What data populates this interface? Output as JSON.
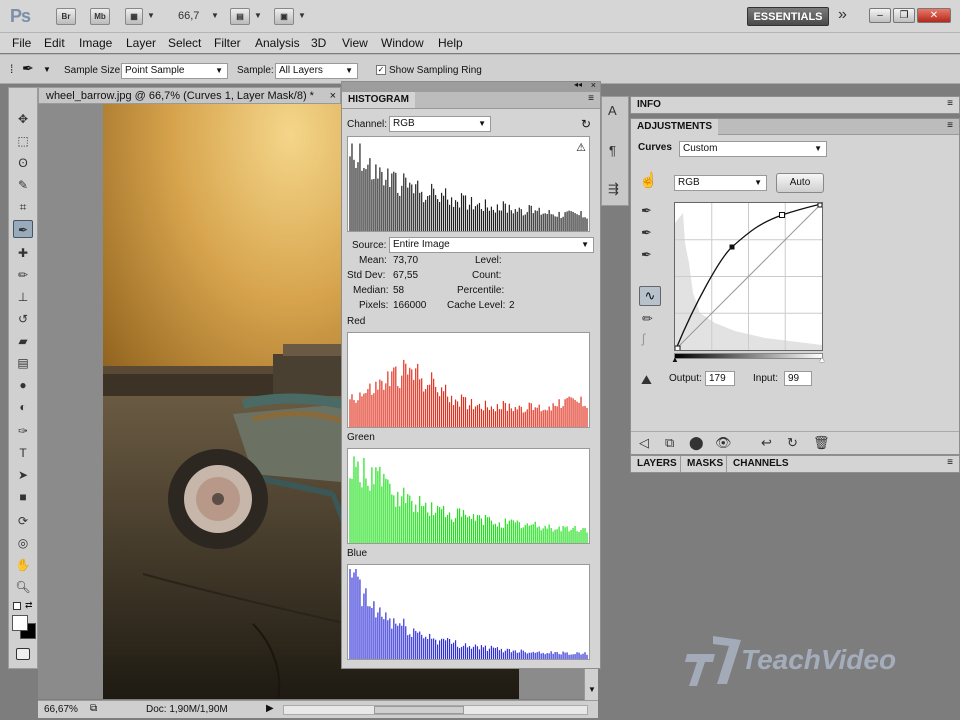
{
  "app": {
    "logo": "Ps",
    "bridge_label": "Br",
    "minibridge_label": "Mb",
    "zoom": "66,7",
    "workspace": "ESSENTIALS"
  },
  "menu": [
    "File",
    "Edit",
    "Image",
    "Layer",
    "Select",
    "Filter",
    "Analysis",
    "3D",
    "View",
    "Window",
    "Help"
  ],
  "options": {
    "sample_size_label": "Sample Size:",
    "sample_size_value": "Point Sample",
    "sample_label": "Sample:",
    "sample_value": "All Layers",
    "show_ring_label": "Show Sampling Ring",
    "show_ring_checked": true
  },
  "document": {
    "tab_title": "wheel_barrow.jpg @ 66,7% (Curves 1, Layer Mask/8) *",
    "status_zoom": "66,67%",
    "status_doc": "Doc: 1,90M/1,90M"
  },
  "histogram": {
    "title": "HISTOGRAM",
    "channel_label": "Channel:",
    "channel_value": "RGB",
    "source_label": "Source:",
    "source_value": "Entire Image",
    "stats": {
      "mean_label": "Mean:",
      "mean": "73,70",
      "stddev_label": "Std Dev:",
      "stddev": "67,55",
      "median_label": "Median:",
      "median": "58",
      "pixels_label": "Pixels:",
      "pixels": "166000",
      "level_label": "Level:",
      "count_label": "Count:",
      "percentile_label": "Percentile:",
      "cache_label": "Cache Level:",
      "cache": "2"
    },
    "channels": [
      "Red",
      "Green",
      "Blue"
    ],
    "colors": {
      "rgb": "#222222",
      "red": "#e0301e",
      "green": "#22e01e",
      "blue": "#3030d8"
    }
  },
  "info_tab": "INFO",
  "adjustments": {
    "title": "ADJUSTMENTS",
    "curves_label": "Curves",
    "preset_value": "Custom",
    "channel_value": "RGB",
    "auto_label": "Auto",
    "output_label": "Output:",
    "output_value": "179",
    "input_label": "Input:",
    "input_value": "99"
  },
  "layers_tabs": [
    "LAYERS",
    "MASKS",
    "CHANNELS"
  ],
  "watermark": "TeachVideo"
}
